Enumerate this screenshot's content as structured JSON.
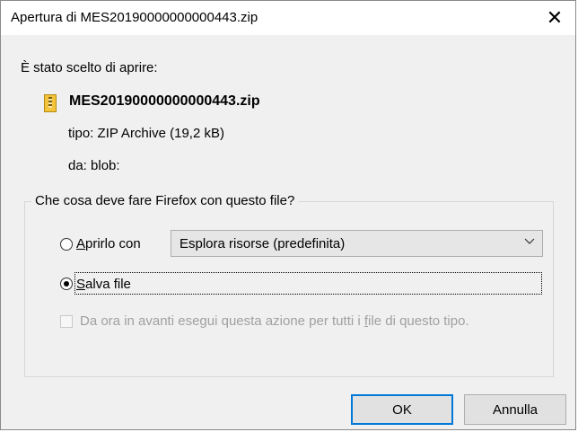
{
  "window": {
    "title": "Apertura di MES20190000000000443.zip",
    "close_symbol": "✕"
  },
  "file": {
    "chosen_label": "È stato scelto di aprire:",
    "name": "MES20190000000000443.zip",
    "type_label": "tipo:",
    "type_value": "ZIP Archive (19,2 kB)",
    "from_label": "da:",
    "from_value": "blob:",
    "icon": "zip-file-icon"
  },
  "action": {
    "group_label": "Che cosa deve fare Firefox con questo file?",
    "open_with_prefix": "",
    "open_with_mnemonic": "A",
    "open_with_rest": "prirlo con",
    "open_with_selected": false,
    "open_with_app": "Esplora risorse (predefinita)",
    "save_mnemonic": "S",
    "save_rest": "alva file",
    "save_selected": true,
    "remember_prefix": "Da ora in avanti esegui questa azione per tutti i ",
    "remember_mnemonic": "f",
    "remember_suffix": "ile di questo tipo.",
    "remember_checked": false
  },
  "buttons": {
    "ok": "OK",
    "cancel": "Annulla"
  },
  "colors": {
    "focus_border": "#0078d7",
    "dialog_bg": "#f0f0f0"
  }
}
